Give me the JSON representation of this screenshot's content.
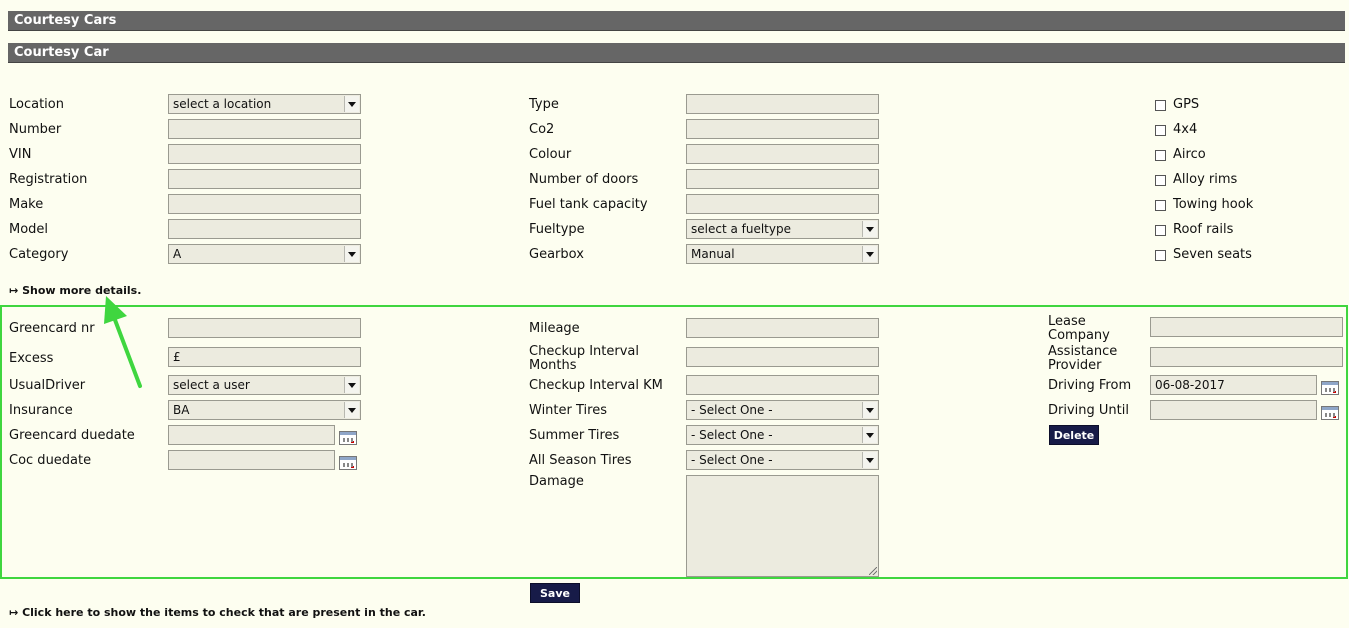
{
  "header": {
    "title": "Courtesy Cars",
    "subtitle": "Courtesy Car"
  },
  "col1": {
    "location": {
      "label": "Location",
      "value": "select a location"
    },
    "number": {
      "label": "Number",
      "value": ""
    },
    "vin": {
      "label": "VIN",
      "value": ""
    },
    "registration": {
      "label": "Registration",
      "value": ""
    },
    "make": {
      "label": "Make",
      "value": ""
    },
    "model": {
      "label": "Model",
      "value": ""
    },
    "category": {
      "label": "Category",
      "value": "A"
    }
  },
  "col2": {
    "type": {
      "label": "Type",
      "value": ""
    },
    "co2": {
      "label": "Co2",
      "value": ""
    },
    "colour": {
      "label": "Colour",
      "value": ""
    },
    "doors": {
      "label": "Number of doors",
      "value": ""
    },
    "fuel_tank": {
      "label": "Fuel tank capacity",
      "value": ""
    },
    "fueltype": {
      "label": "Fueltype",
      "value": "select a fueltype"
    },
    "gearbox": {
      "label": "Gearbox",
      "value": "Manual"
    }
  },
  "options": [
    "GPS",
    "4x4",
    "Airco",
    "Alloy rims",
    "Towing hook",
    "Roof rails",
    "Seven seats"
  ],
  "show_more_link": "Show more details.",
  "details": {
    "greencard_nr": {
      "label": "Greencard nr",
      "value": ""
    },
    "excess": {
      "label": "Excess",
      "value": "£"
    },
    "usual_driver": {
      "label": "UsualDriver",
      "value": "select a user"
    },
    "insurance": {
      "label": "Insurance",
      "value": "BA"
    },
    "greencard_duedate": {
      "label": "Greencard duedate",
      "value": ""
    },
    "coc_duedate": {
      "label": "Coc duedate",
      "value": ""
    },
    "mileage": {
      "label": "Mileage",
      "value": ""
    },
    "checkup_months": {
      "label_1": "Checkup Interval",
      "label_2": "Months",
      "value": ""
    },
    "checkup_km": {
      "label": "Checkup Interval KM",
      "value": ""
    },
    "winter_tires": {
      "label": "Winter Tires",
      "value": "- Select One -"
    },
    "summer_tires": {
      "label": "Summer Tires",
      "value": "- Select One -"
    },
    "all_season_tires": {
      "label": "All Season Tires",
      "value": "- Select One -"
    },
    "damage": {
      "label": "Damage",
      "value": ""
    },
    "lease_company": {
      "label_1": "Lease",
      "label_2": "Company",
      "value": ""
    },
    "assistance_provider": {
      "label_1": "Assistance",
      "label_2": "Provider",
      "value": ""
    },
    "driving_from": {
      "label": "Driving From",
      "value": "06-08-2017"
    },
    "driving_until": {
      "label": "Driving Until",
      "value": ""
    },
    "delete_label": "Delete"
  },
  "save_label": "Save",
  "items_link": "Click here to show the items to check that are present in the car.",
  "link_arrow": "↦",
  "colors": {
    "header_bar": "#666666",
    "button": "#171b48",
    "highlight": "#3fd63f",
    "background": "#fdfef0",
    "field": "#ecebdf"
  }
}
